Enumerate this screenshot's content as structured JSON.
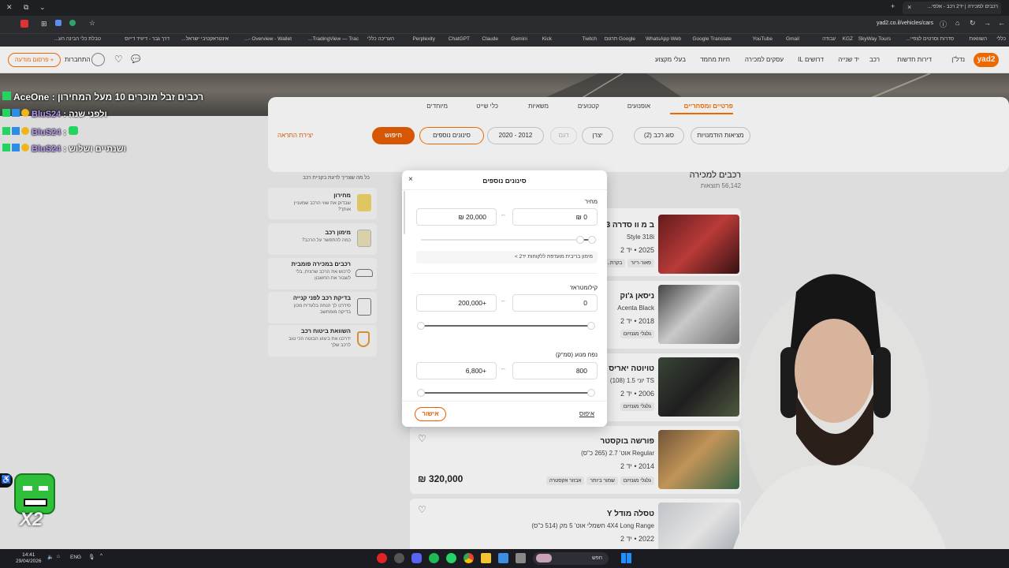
{
  "browser": {
    "tab_title": "רכבים למכירה | יד2 רכב - אלפי...",
    "url": "yad2.co.il/vehicles/cars",
    "bookmarks": [
      "כללי",
      "השוואות",
      "סדרות וסרטים לצפיי...",
      "SkyWay Tours",
      "KGZ",
      "עבודה",
      "Gmail",
      "YouTube",
      "Google Translate",
      "WhatsApp Web",
      "Google תרגום",
      "Twitch",
      "Kick",
      "Gemini",
      "Claude",
      "ChatGPT",
      "Perplexity",
      "העריכה כללי",
      "TradingView — Trac...",
      "Overview - Wallet -...",
      "אינטראקטיבי ישראל...",
      "דרך גבר - דיוויד דייוס",
      "טבלת כלי הבינה הע..."
    ]
  },
  "site": {
    "logo": "yad2",
    "nav": [
      "נדל\"ן",
      "דירות חדשות",
      "רכב",
      "יד שנייה",
      "דרושים IL",
      "עסקים למכירה",
      "חיות מחמד",
      "בעלי מקצוע"
    ],
    "login": "התחברות",
    "post_button": "פרסום מודעה",
    "categories": [
      "פרטיים ומסחריים",
      "אופנועים",
      "קטנועים",
      "משאיות",
      "כלי שייט",
      "מיוחדים"
    ],
    "filters": {
      "deals": "מציאות הזדמנויות",
      "type": "סוג רכב (2)",
      "maker": "יצרן",
      "model": "דגם",
      "year": "2012 - 2020",
      "more": "סינונים נוספים",
      "search": "חיפוש",
      "alert": "יצירת התראה"
    },
    "results_title": "רכבים למכירה",
    "results_count": "56,142 תוצאות",
    "listings": [
      {
        "title": "ב מ וו סדרה 3",
        "sub": "Style 318i",
        "year": "2025",
        "hand": "יד 2",
        "tags": [
          "בקרת...",
          "פאור-ריור"
        ]
      },
      {
        "title": "ניסאן ג'וק",
        "sub": "Acenta Black",
        "year": "2018",
        "hand": "יד 2",
        "tags": [
          "גלגלי מגנזיום"
        ]
      },
      {
        "title": "טויוטה יאריס",
        "sub": "TS יוני 1.5 (108)",
        "year": "2006",
        "hand": "יד 2",
        "tags": [
          "גלגלי מגנזיום"
        ]
      },
      {
        "title": "פורשה בוקסטר",
        "sub": "Regular אוט' 2.7 (265 כ\"ס)",
        "year": "2014",
        "hand": "יד 2",
        "price": "320,000 ₪",
        "tags": [
          "גלגלי מגנזיום",
          "שמור ביותר",
          "אבזור אקסטרה"
        ]
      },
      {
        "title": "טסלה מודל Y",
        "sub": "4X4 Long Range חשמלי אוט' 5 מק (514 כ\"ס)",
        "year": "2022",
        "hand": "יד 2"
      }
    ],
    "sidebar_header": "כל מה שצריך לדעת בקניית רכב",
    "sidebar": [
      {
        "title": "מחירון",
        "desc": "שבדוק את שווי הרכב שמעניין אותך?"
      },
      {
        "title": "מימון רכב",
        "desc": "כמה להתפשר על הרכב?"
      },
      {
        "title": "רכבים במכירה פומבית",
        "desc": "לרכוש את הרכב שרצית, בלי לשבור את החשבון"
      },
      {
        "title": "בדיקת רכב לפני קנייה",
        "desc": "סידרנו לך הנחה בלעדית מכון בדיקה מומחשב"
      },
      {
        "title": "השוואת ביטוח רכב",
        "desc": "ידרכנו את ביצוע הבוטה הכי טוב לרכב שלך"
      }
    ]
  },
  "modal": {
    "title": "סינונים נוספים",
    "price_label": "מחיר",
    "price_min": "0 ₪",
    "price_max": "20,000 ₪",
    "price_note": "מימון בריבית מועדפת ללקוחות יד2 >",
    "km_label": "קילומטראז'",
    "km_min": "0",
    "km_max": "+200,000",
    "engine_label": "נפח מנוע (סמ\"ק)",
    "engine_min": "800",
    "engine_max": "+6,800",
    "dash": "--",
    "reset": "איפוס",
    "confirm": "אישור"
  },
  "stream": {
    "chat": [
      {
        "user": "AceOne",
        "msg": "רכבים זבל מוכרים 10 מעל המחירון",
        "color": "#ffffff"
      },
      {
        "user": "BluS24",
        "msg": "ולפני שנה",
        "color": "#b79cf0"
      },
      {
        "user": "BluS24",
        "msg": "",
        "color": "#b79cf0"
      },
      {
        "user": "BluS24",
        "msg": "ושנתיים ושלוש",
        "color": "#b79cf0"
      }
    ],
    "multiplier": "X2"
  },
  "taskbar": {
    "time": "14:41",
    "date": "29/04/2026",
    "lang": "ENG",
    "search": "חפש"
  }
}
